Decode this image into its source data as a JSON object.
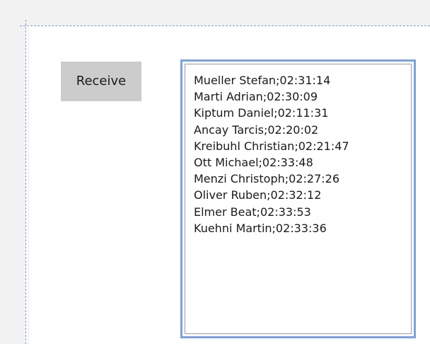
{
  "form": {
    "receive_button_label": "Receive"
  },
  "results_list": {
    "items": [
      "Mueller Stefan;02:31:14",
      "Marti Adrian;02:30:09",
      "Kiptum Daniel;02:11:31",
      "Ancay Tarcis;02:20:02",
      "Kreibuhl Christian;02:21:47",
      "Ott Michael;02:33:48",
      "Menzi Christoph;02:27:26",
      "Oliver Ruben;02:32:12",
      "Elmer Beat;02:33:53",
      "Kuehni Martin;02:33:36"
    ]
  },
  "colors": {
    "surface_background": "#f2f2f2",
    "panel_background": "#ffffff",
    "button_background": "#cccccc",
    "list_focus_border": "#7aa2dd",
    "list_inner_border": "#9c9c9c",
    "designer_guide": "#7a9cc4"
  }
}
